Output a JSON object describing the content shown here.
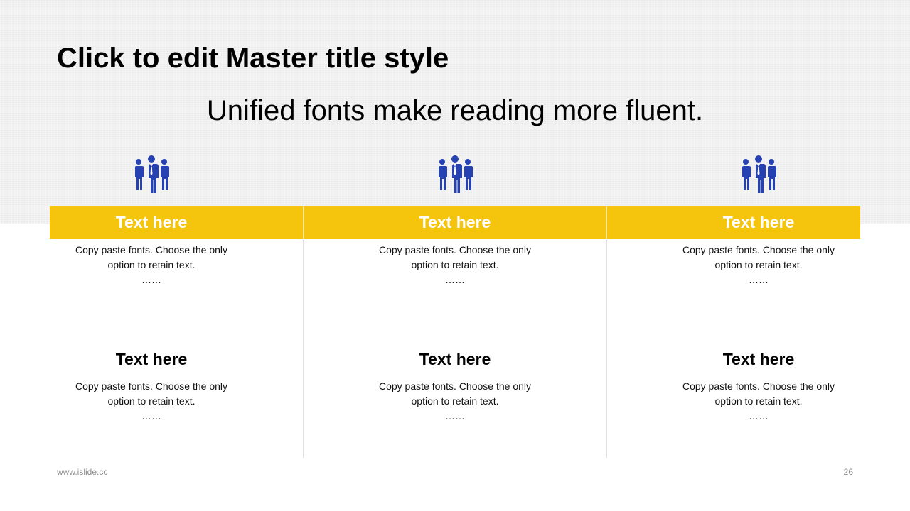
{
  "slide": {
    "title": "Click to edit Master title style",
    "subtitle": "Unified fonts make reading more fluent.",
    "accent_color": "#f4c50c",
    "icon_color": "#2541b2",
    "columns": [
      {
        "icon": "team-icon",
        "header": "Text here",
        "top_text_line1": "Copy paste fonts. Choose the only",
        "top_text_line2": "option to retain text.",
        "top_text_ellipsis": "……",
        "sub_heading": "Text here",
        "bottom_text_line1": "Copy paste fonts. Choose the only",
        "bottom_text_line2": "option to retain text.",
        "bottom_text_ellipsis": "……"
      },
      {
        "icon": "team-icon",
        "header": "Text here",
        "top_text_line1": "Copy paste fonts. Choose the only",
        "top_text_line2": "option to retain text.",
        "top_text_ellipsis": "……",
        "sub_heading": "Text here",
        "bottom_text_line1": "Copy paste fonts. Choose the only",
        "bottom_text_line2": "option to retain text.",
        "bottom_text_ellipsis": "……"
      },
      {
        "icon": "team-icon",
        "header": "Text here",
        "top_text_line1": "Copy paste fonts. Choose the only",
        "top_text_line2": "option to retain text.",
        "top_text_ellipsis": "……",
        "sub_heading": "Text here",
        "bottom_text_line1": "Copy paste fonts. Choose the only",
        "bottom_text_line2": "option to retain text.",
        "bottom_text_ellipsis": "……"
      }
    ]
  },
  "footer": {
    "website": "www.islide.cc",
    "page_number": "26"
  }
}
